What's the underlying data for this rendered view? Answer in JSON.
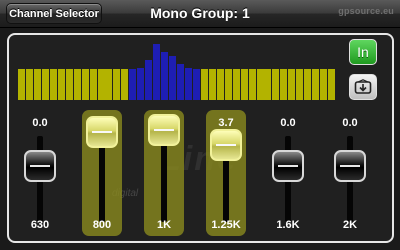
{
  "header": {
    "back_label": "Channel Selector",
    "title": "Mono Group: 1",
    "logo_text": "gpsource.eu"
  },
  "watermark": {
    "brand": "Line",
    "sub": "digital"
  },
  "controls": {
    "in_label": "In",
    "load_icon": "load-icon"
  },
  "colors": {
    "meter_yellow": "#b3b300",
    "meter_blue": "#1e1eb4",
    "selected_fader": "#8c8c1e",
    "in_button": "#2fb02f"
  },
  "meter": {
    "levels": [
      0.55,
      0.55,
      0.55,
      0.55,
      0.55,
      0.55,
      0.55,
      0.55,
      0.55,
      0.55,
      0.55,
      0.55,
      0.55,
      0.55,
      0.55,
      0.58,
      0.72,
      1.0,
      0.85,
      0.78,
      0.65,
      0.58,
      0.55,
      0.55,
      0.55,
      0.55,
      0.55,
      0.55,
      0.55,
      0.55,
      0.55,
      0.55,
      0.55,
      0.55,
      0.55,
      0.55,
      0.55,
      0.55,
      0.55,
      0.55
    ],
    "blue_range": [
      14,
      22
    ]
  },
  "channels": [
    {
      "value": "0.0",
      "freq": "630",
      "selected": false,
      "level": 0.0
    },
    {
      "value": "7.5",
      "freq": "800",
      "selected": true,
      "level": 0.9
    },
    {
      "value": "8.6",
      "freq": "1K",
      "selected": true,
      "level": 0.95
    },
    {
      "value": "3.7",
      "freq": "1.25K",
      "selected": true,
      "level": 0.55
    },
    {
      "value": "0.0",
      "freq": "1.6K",
      "selected": false,
      "level": 0.0
    },
    {
      "value": "0.0",
      "freq": "2K",
      "selected": false,
      "level": 0.0
    }
  ]
}
